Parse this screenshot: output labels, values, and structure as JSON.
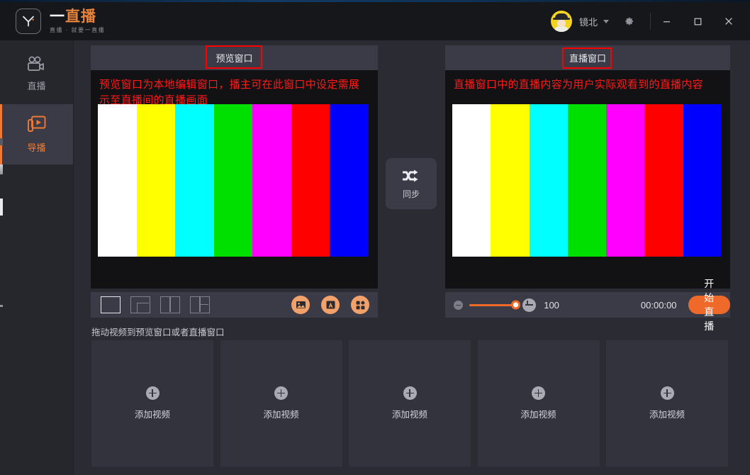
{
  "app": {
    "brand_name_1": "一",
    "brand_name_2": "直播",
    "brand_tagline": "直播 · 就要一直播",
    "logo_icon": "y-logo-icon"
  },
  "titlebar": {
    "username": "镜北",
    "caret_icon": "chevron-down-icon",
    "settings_icon": "gear-icon",
    "minimize_icon": "minimize-icon",
    "maximize_icon": "maximize-icon",
    "close_icon": "close-icon",
    "avatar_icon": "user-avatar"
  },
  "sidebar": {
    "items": [
      {
        "label": "直播",
        "icon": "video-camera-icon",
        "active": false
      },
      {
        "label": "导播",
        "icon": "broadcast-layers-icon",
        "active": true
      }
    ]
  },
  "preview_panel": {
    "title": "预览窗口",
    "annotation": "预览窗口为本地编辑窗口，播主可在此窗口中设定需展示至直播间的直播画面",
    "highlight_color": "#ff0000",
    "annotation_color": "#ff1a1a"
  },
  "live_panel": {
    "title": "直播窗口",
    "annotation": "直播窗口中的直播内容为用户实际观看到的直播内容",
    "highlight_color": "#ff0000",
    "annotation_color": "#ff1a1a"
  },
  "color_bars": {
    "colors": [
      "#ffffff",
      "#ffff00",
      "#00ffff",
      "#00e000",
      "#ff00ff",
      "#ff0000",
      "#0000ff"
    ],
    "names": [
      "white",
      "yellow",
      "cyan",
      "green",
      "magenta",
      "red",
      "blue"
    ]
  },
  "sync_button": {
    "label": "同步",
    "icon": "shuffle-arrows-icon"
  },
  "preview_toolbar": {
    "layouts": [
      {
        "name": "layout-single",
        "selected": true
      },
      {
        "name": "layout-pip",
        "selected": false
      },
      {
        "name": "layout-two-column",
        "selected": false
      },
      {
        "name": "layout-one-left-two-right",
        "selected": false
      }
    ],
    "actions": [
      {
        "name": "add-image-button",
        "icon": "image-icon"
      },
      {
        "name": "add-text-button",
        "icon": "text-a-icon"
      },
      {
        "name": "add-widget-button",
        "icon": "grid-squares-icon"
      }
    ],
    "accent_color": "#f2a16a"
  },
  "live_controls": {
    "volume_minus_icon": "minus-circle-icon",
    "volume_plus_icon": "plus-circle-icon",
    "volume_value": "100",
    "volume_percent": 100,
    "timer": "00:00:00",
    "start_button_label": "开始直播",
    "start_button_color": "#ef6a2a",
    "slider_color": "#ef6a2a"
  },
  "library": {
    "drag_hint": "拖动视频到预览窗口或者直播窗口",
    "cards": [
      {
        "label": "添加视频",
        "icon": "plus-circle-icon"
      },
      {
        "label": "添加视频",
        "icon": "plus-circle-icon"
      },
      {
        "label": "添加视频",
        "icon": "plus-circle-icon"
      },
      {
        "label": "添加视频",
        "icon": "plus-circle-icon"
      },
      {
        "label": "添加视频",
        "icon": "plus-circle-icon"
      }
    ]
  },
  "theme": {
    "background": "#2b2b33",
    "panel_header": "#3a3b46",
    "video_background": "#121214",
    "accent_orange": "#ef7a34",
    "titlebar": "#16171a"
  }
}
